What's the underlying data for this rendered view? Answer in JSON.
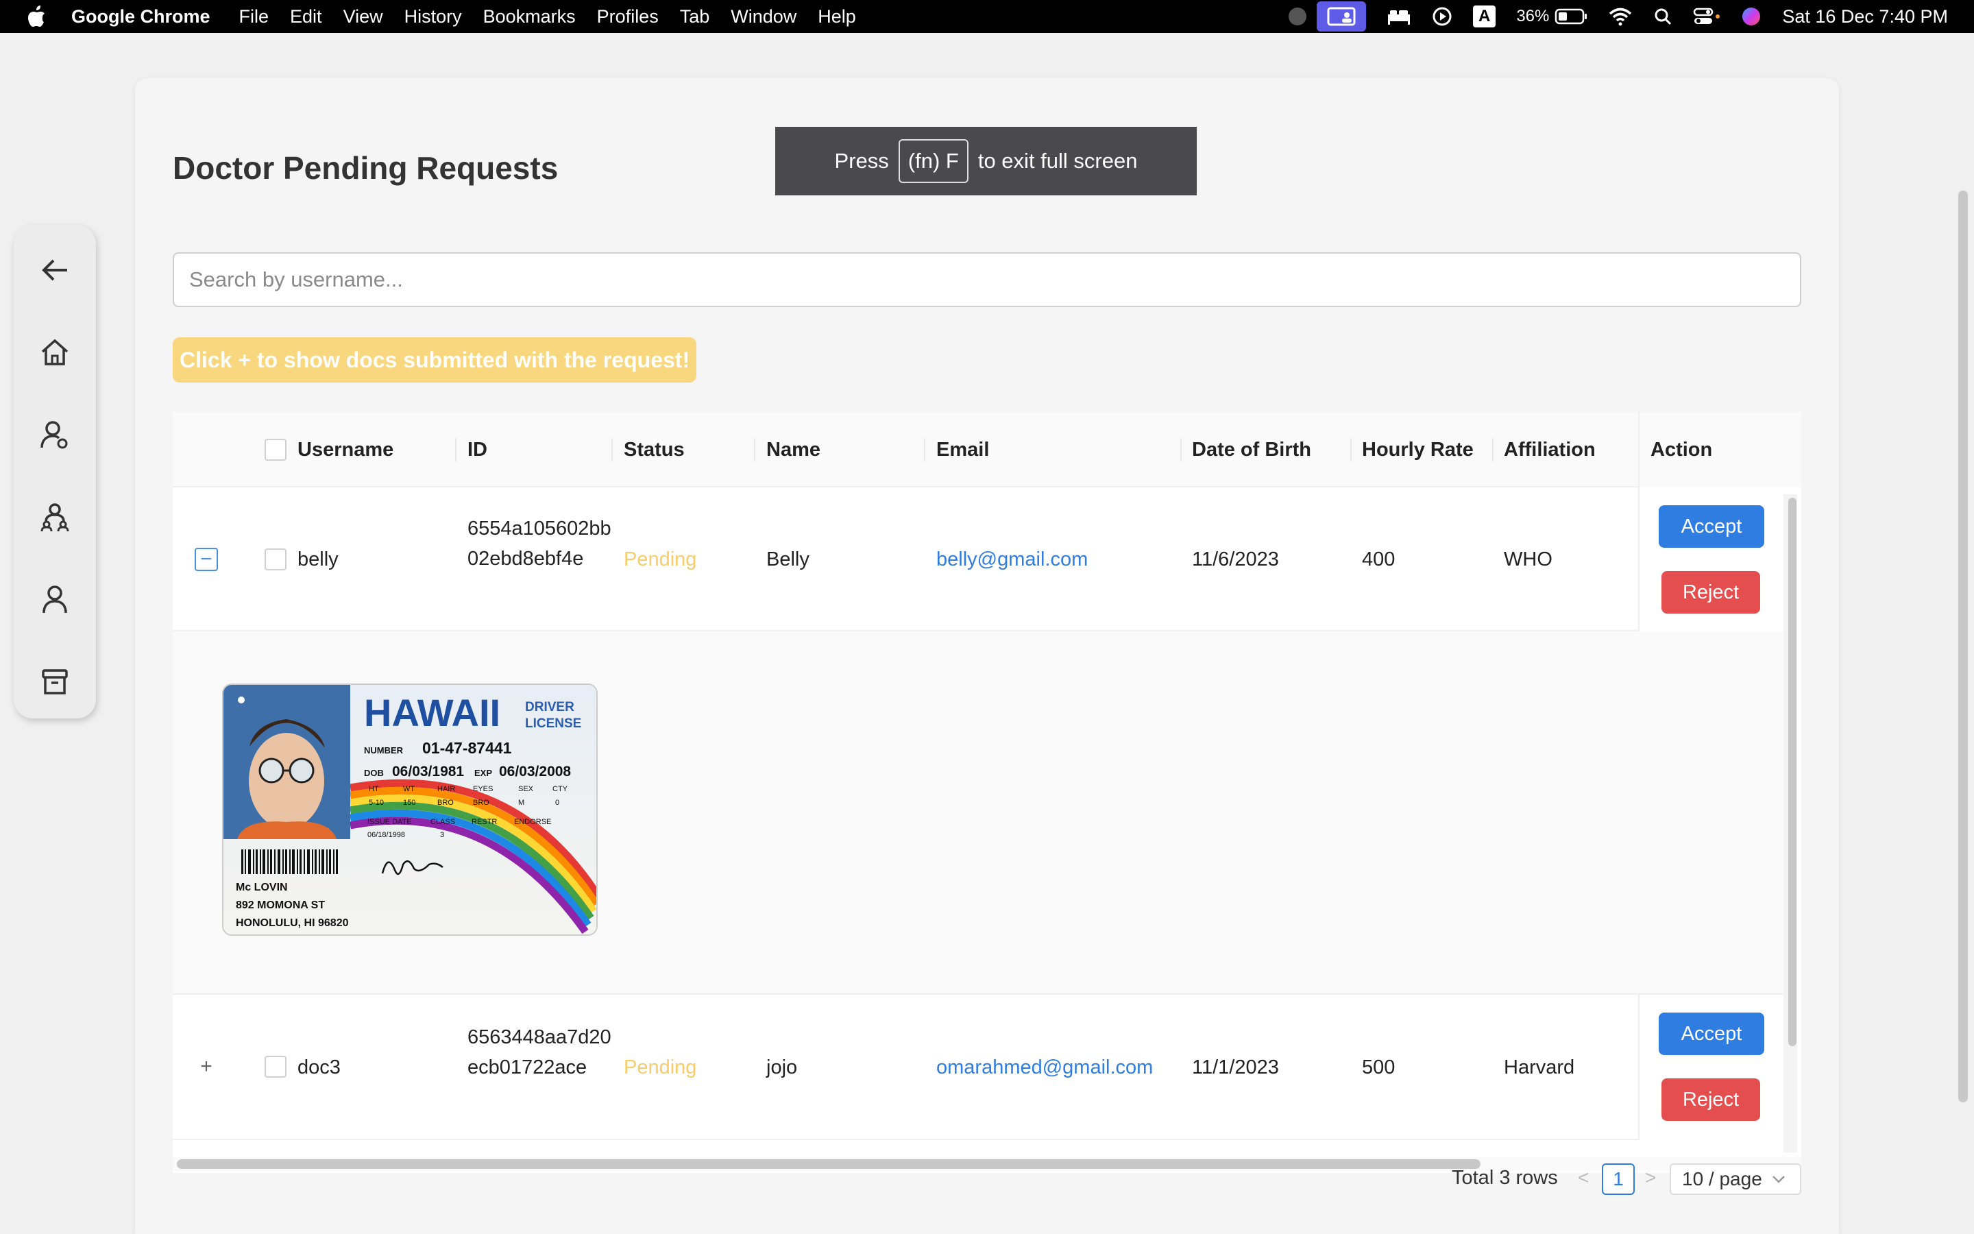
{
  "menubar": {
    "app_name": "Google Chrome",
    "items": [
      "File",
      "Edit",
      "View",
      "History",
      "Bookmarks",
      "Profiles",
      "Tab",
      "Window",
      "Help"
    ],
    "battery": "36%",
    "clock": "Sat 16 Dec  7:40 PM",
    "input_source": "A"
  },
  "toast": {
    "prefix": "Press",
    "key": "(fn) F",
    "suffix": "to exit full screen"
  },
  "page": {
    "title": "Doctor Pending Requests",
    "search_placeholder": "Search by username...",
    "hint": "Click + to show docs submitted with the request!"
  },
  "sidebar": {
    "icons": [
      "back-arrow-icon",
      "home-icon",
      "doctor-user-icon",
      "team-icon",
      "user-icon",
      "archive-icon"
    ]
  },
  "table": {
    "columns": {
      "username": "Username",
      "id": "ID",
      "status": "Status",
      "name": "Name",
      "email": "Email",
      "dob": "Date of Birth",
      "rate": "Hourly Rate",
      "affiliation": "Affiliation",
      "action": "Action"
    },
    "rows": [
      {
        "expand": "−",
        "username": "belly",
        "id": "6554a105602bb02ebd8ebf4e",
        "status": "Pending",
        "name": "Belly",
        "email": "belly@gmail.com",
        "dob": "11/6/2023",
        "rate": "400",
        "affiliation": "WHO",
        "accept": "Accept",
        "reject": "Reject"
      },
      {
        "expand": "+",
        "username": "doc3",
        "id": "6563448aa7d20ecb01722ace",
        "status": "Pending",
        "name": "jojo",
        "email": "omarahmed@gmail.com",
        "dob": "11/1/2023",
        "rate": "500",
        "affiliation": "Harvard",
        "accept": "Accept",
        "reject": "Reject"
      }
    ],
    "document": {
      "state": "HAWAII",
      "type_line1": "DRIVER",
      "type_line2": "LICENSE",
      "number_label": "NUMBER",
      "number": "01-47-87441",
      "dob_label": "DOB",
      "dob": "06/03/1981",
      "exp_label": "EXP",
      "exp": "06/03/2008",
      "field_labels": [
        "HT",
        "WT",
        "HAIR",
        "EYES",
        "SEX",
        "CTY"
      ],
      "field_values": [
        "5-10",
        "150",
        "BRO",
        "BRO",
        "M",
        "0"
      ],
      "issue_labels": [
        "ISSUE DATE",
        "CLASS",
        "RESTR",
        "ENDORSE"
      ],
      "issue_values": [
        "06/18/1998",
        "3"
      ],
      "holder_name": "Mc LOVIN",
      "address1": "892 MOMONA ST",
      "address2": "HONOLULU, HI 96820"
    }
  },
  "pagination": {
    "total": "Total 3 rows",
    "prev": "<",
    "current": "1",
    "next": ">",
    "page_size": "10 / page"
  },
  "colors": {
    "primary": "#2f7de1",
    "danger": "#e44e4e",
    "pending": "#f7cc6a",
    "hint_bg": "#f9d77e"
  }
}
